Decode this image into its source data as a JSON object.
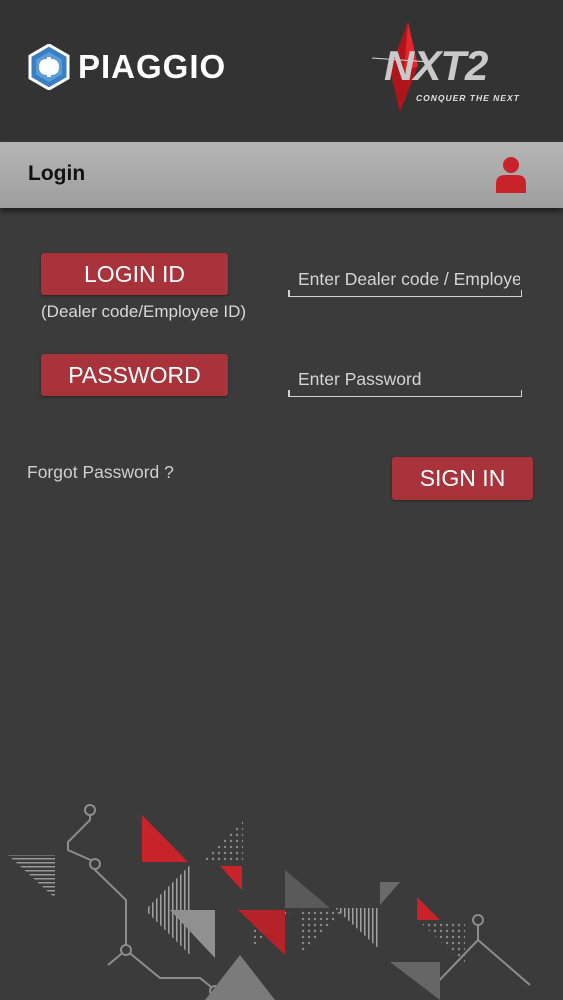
{
  "header": {
    "brand_name": "PIAGGIO",
    "product_logo_text": "NXT2",
    "product_tagline": "CONQUER THE NEXT"
  },
  "title_bar": {
    "title": "Login",
    "user_icon": "user-icon"
  },
  "login_form": {
    "login_id_label": "LOGIN ID",
    "login_id_hint": "(Dealer code/Employee ID)",
    "login_id_placeholder": "Enter Dealer code / Employee",
    "password_label": "PASSWORD",
    "password_placeholder": "Enter Password",
    "forgot_password": "Forgot Password ?",
    "sign_in": "SIGN IN"
  },
  "colors": {
    "accent_red": "#a9333a",
    "background": "#3b3b3c",
    "header_bg": "#333334",
    "title_bar_bg": "#aaaaaa"
  }
}
